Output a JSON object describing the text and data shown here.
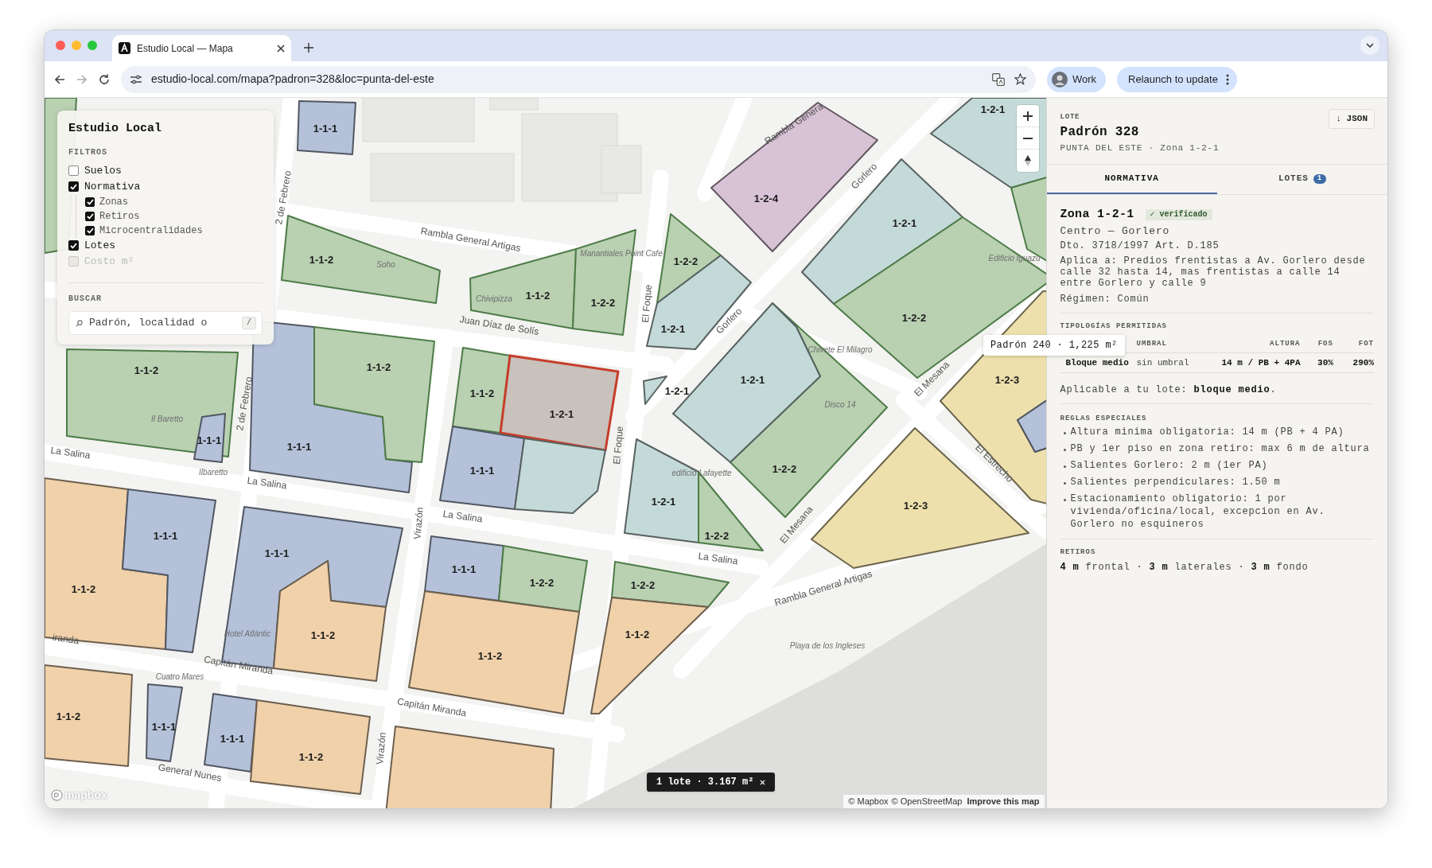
{
  "browser": {
    "tab_title": "Estudio Local — Mapa",
    "url": "estudio-local.com/mapa?padron=328&loc=punta-del-este",
    "profile": "Work",
    "update_button": "Relaunch to update"
  },
  "filters_panel": {
    "title": "Estudio Local",
    "filters_heading": "FILTROS",
    "filters": [
      {
        "label": "Suelos",
        "checked": false,
        "disabled": false
      },
      {
        "label": "Normativa",
        "checked": true,
        "disabled": false,
        "children": [
          {
            "label": "Zonas",
            "checked": true
          },
          {
            "label": "Retiros",
            "checked": true
          },
          {
            "label": "Microcentralidades",
            "checked": true
          }
        ]
      },
      {
        "label": "Lotes",
        "checked": true,
        "disabled": false
      },
      {
        "label": "Costo m²",
        "checked": false,
        "disabled": true
      }
    ],
    "search_heading": "BUSCAR",
    "search": {
      "placeholder": "Padrón, localidad o",
      "shortcut": "/"
    }
  },
  "map": {
    "zones": [
      {
        "label": "1-1-1",
        "color": "#b4c1d9",
        "selected": false
      },
      {
        "label": "1-1-2",
        "color": "#b9d0b1",
        "selected": false
      },
      {
        "label": "1-1-2",
        "color": "#b9d0b1",
        "selected": false
      },
      {
        "label": "1-2-2",
        "color": "#b9d0b1",
        "selected": false
      },
      {
        "label": "1-2-2",
        "color": "#b9d0b1",
        "selected": false
      },
      {
        "label": "1-2-1",
        "color": "#c4dad8",
        "selected": false
      },
      {
        "label": "1-2-4",
        "color": "#d8c2d5",
        "selected": false
      },
      {
        "label": "1-2-1",
        "color": "#c4dad8",
        "selected": false
      },
      {
        "label": "1-2-2",
        "color": "#b9d0b1",
        "selected": false
      },
      {
        "label": "1-2-1",
        "color": "#c4dad8",
        "selected": false
      },
      {
        "color": "#b9d0b1",
        "selected": false
      },
      {
        "label": "1-2-2",
        "color": "#b9d0b1",
        "selected": false
      },
      {
        "label": "1-2-1",
        "color": "#c4dad8",
        "selected": false
      },
      {
        "label": "1-2-1",
        "color": "#c4dad8",
        "selected": false
      },
      {
        "label": "1-1-2",
        "color": "#b9d0b1",
        "selected": false
      },
      {
        "label": "1-2-1",
        "color": "#c8c1bc",
        "selected": true
      },
      {
        "label": "1-1-1",
        "color": "#b4c1d9",
        "selected": false
      },
      {
        "color": "#c4dad8",
        "selected": false
      },
      {
        "label": "1-1-1",
        "color": "#b4c1d9",
        "selected": false
      },
      {
        "label": "1-1-2",
        "color": "#b9d0b1",
        "selected": false
      },
      {
        "label": "1-1-2",
        "color": "#b9d0b1",
        "selected": false
      },
      {
        "label": "1-1-1",
        "color": "#b4c1d9",
        "selected": false
      },
      {
        "color": "#b9d0b1",
        "selected": false
      },
      {
        "label": "1-1-2",
        "color": "#f0d1aa",
        "selected": false
      },
      {
        "label": "1-1-1",
        "color": "#b4c1d9",
        "selected": false
      },
      {
        "label": "1-1-1",
        "color": "#b4c1d9",
        "selected": false
      },
      {
        "label": "1-1-2",
        "color": "#f0d1aa",
        "selected": false
      },
      {
        "label": "1-1-1",
        "color": "#b4c1d9",
        "selected": false
      },
      {
        "label": "1-2-2",
        "color": "#b9d0b1",
        "selected": false
      },
      {
        "label": "1-1-2",
        "color": "#f0d1aa",
        "selected": false
      },
      {
        "label": "1-2-2",
        "color": "#b9d0b1",
        "selected": false
      },
      {
        "label": "1-1-2",
        "color": "#f0d1aa",
        "selected": false
      },
      {
        "label": "1-2-1",
        "color": "#c4dad8",
        "selected": false
      },
      {
        "label": "1-2-2",
        "color": "#b9d0b1",
        "selected": false
      },
      {
        "label": "1-2-3",
        "color": "#ede0ac",
        "selected": false
      },
      {
        "label": "1-2-3",
        "color": "#ede0ac",
        "selected": false
      },
      {
        "color": "#b4c1d9",
        "selected": false
      },
      {
        "label": "1-1-2",
        "color": "#f0d1aa",
        "selected": false
      },
      {
        "label": "1-1-1",
        "color": "#b4c1d9",
        "selected": false
      },
      {
        "label": "1-1-1",
        "color": "#b4c1d9",
        "selected": false
      },
      {
        "label": "1-1-2",
        "color": "#f0d1aa",
        "selected": false
      },
      {
        "color": "#f0d1aa",
        "selected": false
      }
    ],
    "street_labels": [
      "Rambla General Artigas",
      "Rambla Genera",
      "Gorlero",
      "Gorlero",
      "2 de Febrero",
      "2 de Febrero",
      "Juan Díaz de Solís",
      "El Foque",
      "El Foque",
      "La Salina",
      "La Salina",
      "La Salina",
      "La Salina",
      "Virazón",
      "Virazón",
      "El Mesana",
      "El Mesana",
      "El Estrecho",
      "Rambla General Artigas",
      "Capitán Miranda",
      "Capitán Miranda",
      "iranda",
      "General Nunes"
    ],
    "place_labels": [
      "Soho",
      "Chivipizza",
      "Manantiales Point Cafe",
      "Edificio Iguazu",
      "Chivete El Milagro",
      "Disco 14",
      "Il Baretto",
      "Ilbaretto",
      "edificio Lafayette",
      "Hotel Atlántic",
      "Cuatro Mares",
      "Playa de los Ingleses"
    ],
    "hover_tooltip": "Padrón 240 · 1,225 m²",
    "selection_pill": "1 lote · 3.167 m²",
    "attribution": [
      "© Mapbox",
      "© OpenStreetMap",
      "Improve this map"
    ],
    "logo": "mapbox"
  },
  "detail_panel": {
    "kicker": "LOTE",
    "title": "Padrón 328",
    "subtitle": "PUNTA DEL ESTE · Zona 1-2-1",
    "export_button": "↓ JSON",
    "tabs": [
      {
        "label": "NORMATIVA",
        "selected": true
      },
      {
        "label": "LOTES",
        "count": "1",
        "selected": false
      }
    ],
    "zone": {
      "name": "Zona 1-2-1",
      "badge": "✓ verificado",
      "area": "Centro — Gorlero",
      "decree": "Dto. 3718/1997 Art. D.185",
      "applies": "Aplica a: Predios frentistas a Av. Gorlero desde calle 32 hasta 14, mas frentistas a calle 14 entre Gorlero y calle 9",
      "regime": "Régimen: Común"
    },
    "typologies": {
      "heading": "TIPOLOGÍAS PERMITIDAS",
      "columns": [
        "UMBRAL",
        "ALTURA",
        "FOS",
        "FOT"
      ],
      "rows": [
        {
          "name": "Bloque medio",
          "umbral": "sin umbral",
          "altura": "14 m / PB + 4PA",
          "fos": "30%",
          "fot": "290%"
        }
      ]
    },
    "applicable": "Aplicable a tu lote: **bloque medio**.",
    "rules_heading": "REGLAS ESPECIALES",
    "rules": [
      "Altura minima obligatoria: 14 m (PB + 4 PA)",
      "PB y 1er piso en zona retiro: max 6 m de altura",
      "Salientes Gorlero: 2 m (1er PA)",
      "Salientes perpendiculares: 1.50 m",
      "Estacionamiento obligatorio: 1 por vivienda/oficina/local, excepcion en Av. Gorlero no esquineros"
    ],
    "retiros_heading": "RETIROS",
    "retiros": "**4 m** frontal · **3 m** laterales · **3 m** fondo"
  }
}
